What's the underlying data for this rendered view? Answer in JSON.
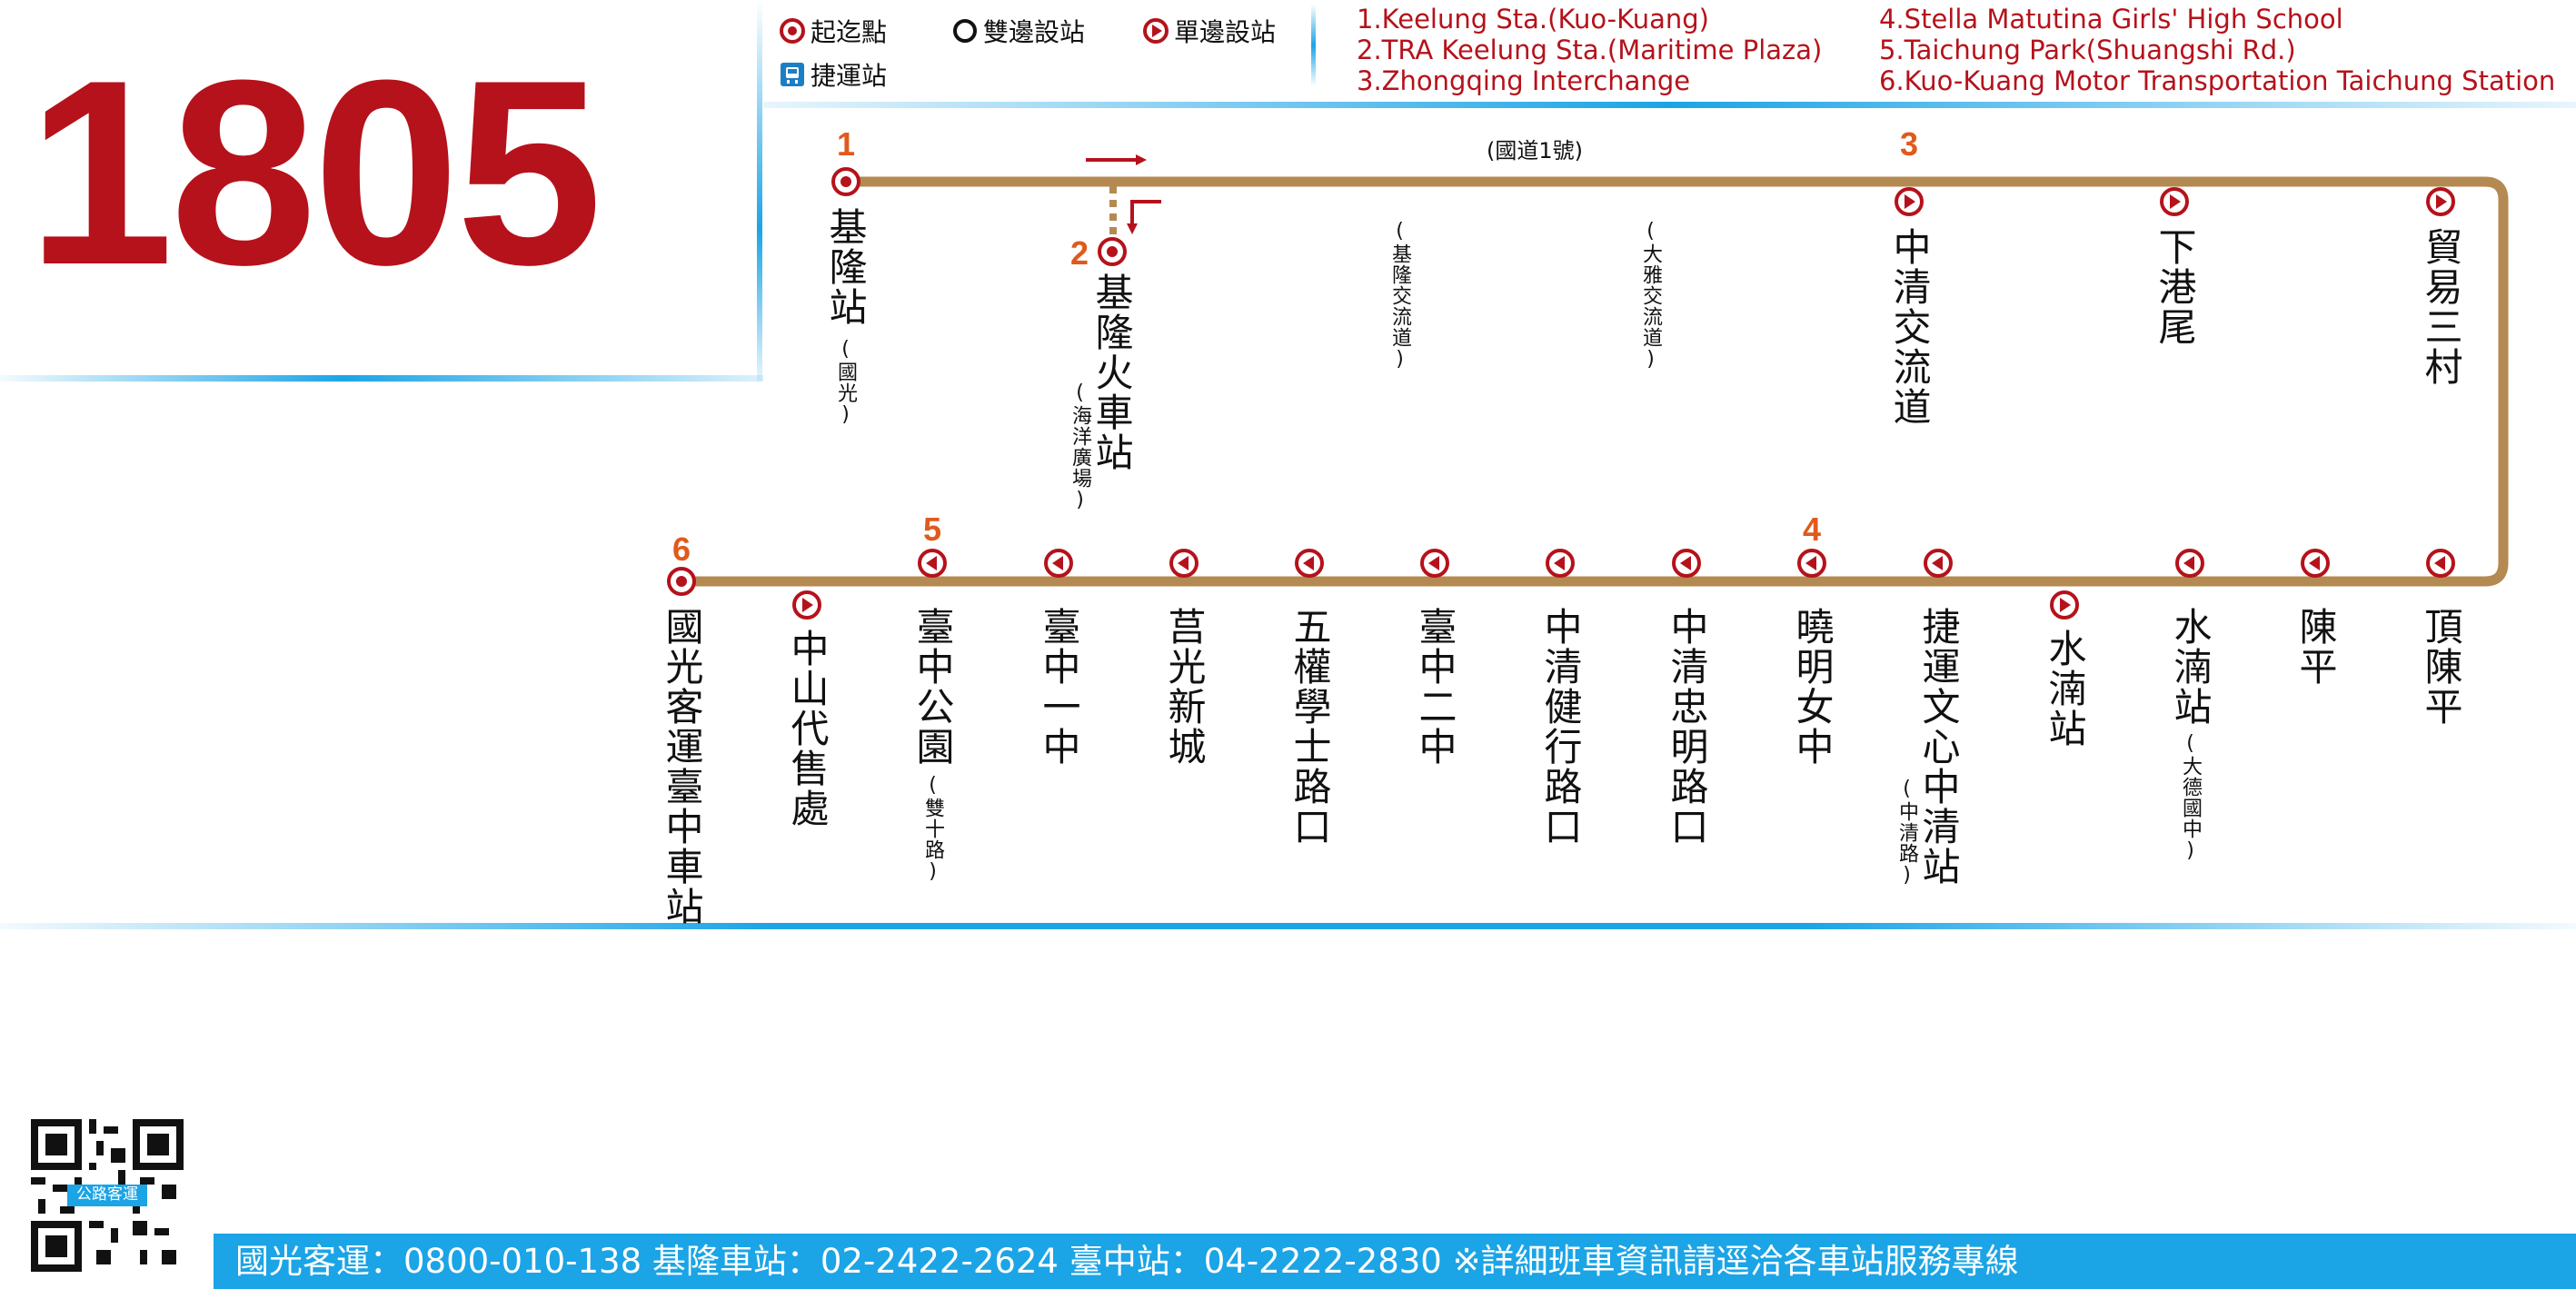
{
  "route": {
    "number": "1805"
  },
  "colors": {
    "route_red": "#b5121b",
    "route_line": "#b48a52",
    "number_orange": "#e05a1c",
    "footer_blue": "#1ba4e6"
  },
  "legend": {
    "terminal": "起迄點",
    "both_sides": "雙邊設站",
    "one_side": "單邊設站",
    "mrt": "捷運站"
  },
  "key_stops": [
    "1.Keelung Sta.(Kuo-Kuang)",
    "2.TRA Keelung Sta.(Maritime Plaza)",
    "3.Zhongqing Interchange",
    "4.Stella Matutina Girls' High School",
    "5.Taichung Park(Shuangshi Rd.)",
    "6.Kuo-Kuang Motor Transportation Taichung Station"
  ],
  "highway_label": "(國道1號)",
  "top_stops": [
    {
      "num": "1",
      "name": "基隆站",
      "sub": "(國光)",
      "icon": "terminal"
    },
    {
      "num": "2",
      "name": "基隆火車站",
      "sub": "(海洋廣場)",
      "icon": "terminal"
    },
    {
      "num": "",
      "name": "",
      "sub": "(基隆交流道)",
      "icon": "none"
    },
    {
      "num": "",
      "name": "",
      "sub": "(大雅交流道)",
      "icon": "none"
    },
    {
      "num": "3",
      "name": "中清交流道",
      "sub": "",
      "icon": "one-side-right"
    },
    {
      "num": "",
      "name": "下港尾",
      "sub": "",
      "icon": "one-side-right"
    },
    {
      "num": "",
      "name": "貿易三村",
      "sub": "",
      "icon": "one-side-right"
    }
  ],
  "bottom_stops": [
    {
      "num": "6",
      "name": "國光客運臺中車站",
      "sub": "",
      "icon": "terminal"
    },
    {
      "num": "",
      "name": "中山代售處",
      "sub": "",
      "icon": "one-side-right"
    },
    {
      "num": "5",
      "name": "臺中公園",
      "sub": "(雙十路)",
      "icon": "one-side-left"
    },
    {
      "num": "",
      "name": "臺中一中",
      "sub": "",
      "icon": "one-side-left"
    },
    {
      "num": "",
      "name": "莒光新城",
      "sub": "",
      "icon": "one-side-left"
    },
    {
      "num": "",
      "name": "五權學士路口",
      "sub": "",
      "icon": "one-side-left"
    },
    {
      "num": "",
      "name": "臺中二中",
      "sub": "",
      "icon": "one-side-left"
    },
    {
      "num": "",
      "name": "中清健行路口",
      "sub": "",
      "icon": "one-side-left"
    },
    {
      "num": "",
      "name": "中清忠明路口",
      "sub": "",
      "icon": "one-side-left"
    },
    {
      "num": "4",
      "name": "曉明女中",
      "sub": "",
      "icon": "one-side-left"
    },
    {
      "num": "",
      "name": "捷運文心中清站",
      "sub": "(中清路)",
      "icon": "one-side-left"
    },
    {
      "num": "",
      "name": "水湳站",
      "sub": "",
      "icon": "one-side-right"
    },
    {
      "num": "",
      "name": "水湳站",
      "sub": "(大德國中)",
      "icon": "one-side-left"
    },
    {
      "num": "",
      "name": "陳平",
      "sub": "",
      "icon": "one-side-left"
    },
    {
      "num": "",
      "name": "頂陳平",
      "sub": "",
      "icon": "one-side-left"
    }
  ],
  "footer": {
    "text": "國光客運：0800-010-138  基隆車站：02-2422-2624  臺中站：04-2222-2830  ※詳細班車資訊請逕洽各車站服務專線"
  },
  "qr_code": {
    "caption": "公路客運"
  }
}
